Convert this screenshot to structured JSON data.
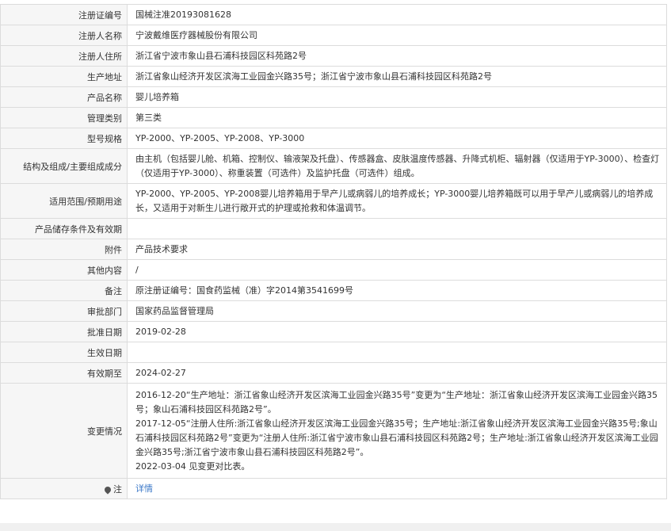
{
  "rows": [
    {
      "label": "注册证编号",
      "value": "国械注准20193081628"
    },
    {
      "label": "注册人名称",
      "value": "宁波戴维医疗器械股份有限公司"
    },
    {
      "label": "注册人住所",
      "value": "浙江省宁波市象山县石浦科技园区科苑路2号"
    },
    {
      "label": "生产地址",
      "value": "浙江省象山经济开发区滨海工业园金兴路35号；浙江省宁波市象山县石浦科技园区科苑路2号"
    },
    {
      "label": "产品名称",
      "value": "婴儿培养箱"
    },
    {
      "label": "管理类别",
      "value": "第三类"
    },
    {
      "label": "型号规格",
      "value": "YP-2000、YP-2005、YP-2008、YP-3000"
    },
    {
      "label": "结构及组成/主要组成成分",
      "value": "由主机（包括婴儿舱、机箱、控制仪、输液架及托盘）、传感器盒、皮肤温度传感器、升降式机柜、辐射器（仅适用于YP-3000）、检查灯（仅适用于YP-3000）、称重装置（可选件）及监护托盘（可选件）组成。"
    },
    {
      "label": "适用范围/预期用途",
      "value": "YP-2000、YP-2005、YP-2008婴儿培养箱用于早产儿或病弱儿的培养成长；YP-3000婴儿培养箱既可以用于早产儿或病弱儿的培养成长，又适用于对新生儿进行敞开式的护理或抢救和体温调节。"
    },
    {
      "label": "产品储存条件及有效期",
      "value": ""
    },
    {
      "label": "附件",
      "value": "产品技术要求"
    },
    {
      "label": "其他内容",
      "value": "/"
    },
    {
      "label": "备注",
      "value": "原注册证编号：国食药监械（准）字2014第3541699号"
    },
    {
      "label": "审批部门",
      "value": "国家药品监督管理局"
    },
    {
      "label": "批准日期",
      "value": "2019-02-28"
    },
    {
      "label": "生效日期",
      "value": ""
    },
    {
      "label": "有效期至",
      "value": "2024-02-27"
    }
  ],
  "changes": {
    "label": "变更情况",
    "entries": [
      "2016-12-20“生产地址：浙江省象山经济开发区滨海工业园金兴路35号”变更为“生产地址：浙江省象山经济开发区滨海工业园金兴路35号；象山石浦科技园区科苑路2号”。",
      "2017-12-05“注册人住所:浙江省象山经济开发区滨海工业园金兴路35号；生产地址:浙江省象山经济开发区滨海工业园金兴路35号;象山石浦科技园区科苑路2号”变更为“注册人住所:浙江省宁波市象山县石浦科技园区科苑路2号；生产地址:浙江省象山经济开发区滨海工业园金兴路35号;浙江省宁波市象山县石浦科技园区科苑路2号”。",
      "2022-03-04 见变更对比表。"
    ]
  },
  "note": {
    "label": "注",
    "icon": "map-pin-icon",
    "link_text": "详情"
  },
  "colors": {
    "label_bg": "#f6f6f6",
    "border": "#dcdcdc",
    "link": "#3b78c8"
  }
}
